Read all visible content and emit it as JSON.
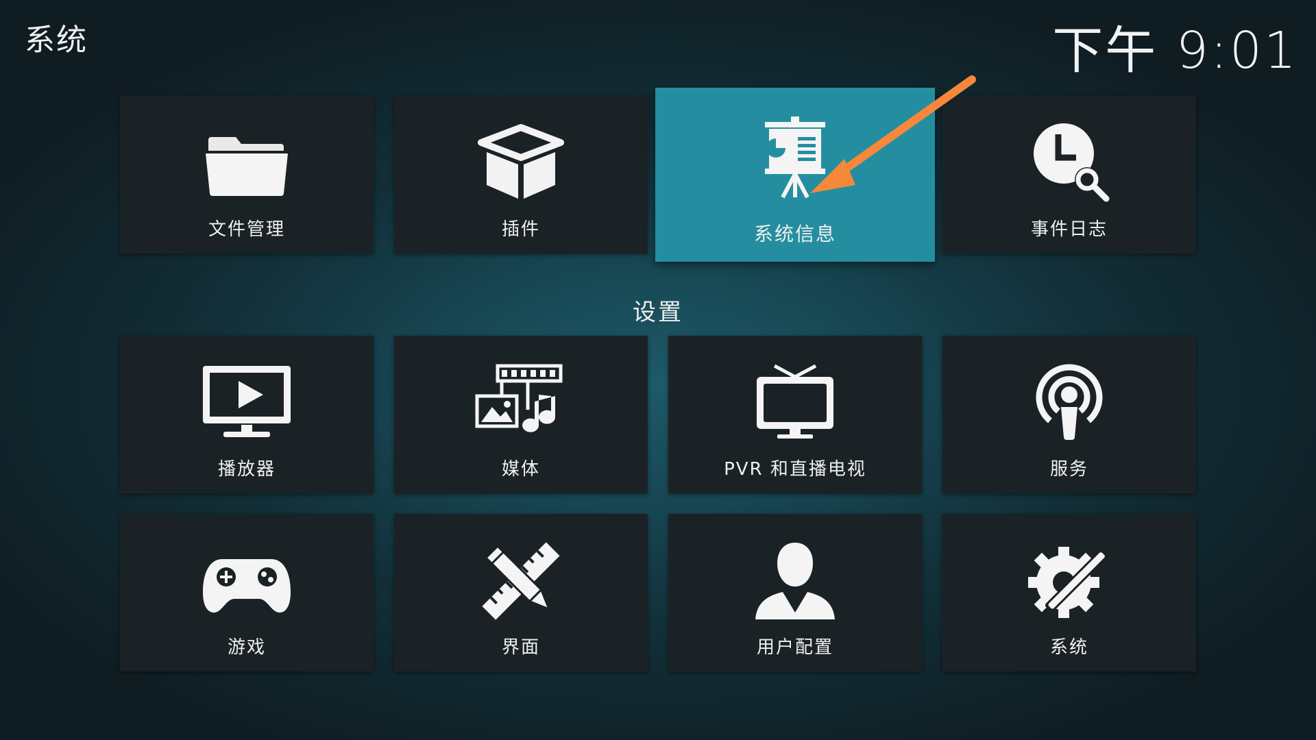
{
  "window_title": "系统",
  "clock": "下午 9:01",
  "top_row": [
    {
      "label": "文件管理",
      "icon": "folder-icon"
    },
    {
      "label": "插件",
      "icon": "addon-box-icon"
    },
    {
      "label": "系统信息",
      "icon": "presentation-board-icon",
      "focused": true
    },
    {
      "label": "事件日志",
      "icon": "clock-search-icon"
    }
  ],
  "settings_title": "设置",
  "settings_row1": [
    {
      "label": "播放器",
      "icon": "tv-play-icon"
    },
    {
      "label": "媒体",
      "icon": "media-film-music-icon"
    },
    {
      "label": "PVR 和直播电视",
      "icon": "television-antenna-icon"
    },
    {
      "label": "服务",
      "icon": "broadcast-icon"
    }
  ],
  "settings_row2": [
    {
      "label": "游戏",
      "icon": "gamepad-icon"
    },
    {
      "label": "界面",
      "icon": "pencil-ruler-icon"
    },
    {
      "label": "用户配置",
      "icon": "user-profile-icon"
    },
    {
      "label": "系统",
      "icon": "gear-tools-icon"
    }
  ],
  "colors": {
    "tile_bg": "#1b2226",
    "focus_bg": "#248ea0",
    "annotation_arrow": "#f5883a"
  }
}
